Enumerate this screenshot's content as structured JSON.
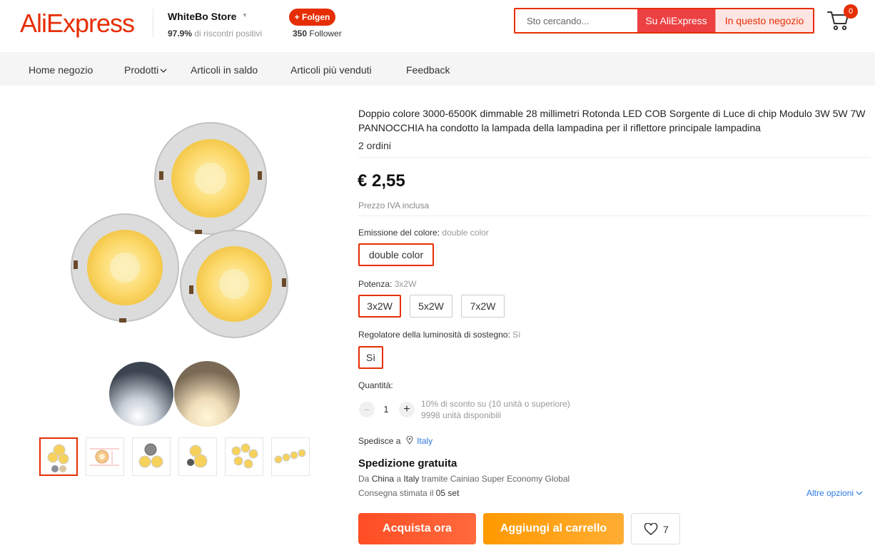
{
  "header": {
    "logo": "AliExpress",
    "store_name": "WhiteBo Store",
    "feedback_percent": "97.9%",
    "feedback_text": " di riscontri positivi",
    "follow_label": "+ Folgen",
    "followers_count": "350",
    "followers_label": " Follower",
    "search_placeholder": "Sto cercando...",
    "search_aliexpress": "Su AliExpress",
    "search_store": "In questo negozio",
    "cart_count": "0"
  },
  "nav": {
    "items": [
      "Home negozio",
      "Prodotti",
      "Articoli in saldo",
      "Articoli più venduti",
      "Feedback"
    ]
  },
  "product": {
    "title": "Doppio colore 3000-6500K dimmable 28 millimetri Rotonda LED COB Sorgente di Luce di chip Modulo 3W 5W 7W PANNOCCHIA ha condotto la lampada della lampadina per il riflettore principale lampadina",
    "orders": "2 ordini",
    "price": "€ 2,55",
    "vat_note": "Prezzo IVA inclusa",
    "color_label": "Emissione del colore:",
    "color_selected": "double color",
    "color_options": [
      "double color"
    ],
    "power_label": "Potenza:",
    "power_selected": "3x2W",
    "power_options": [
      "3x2W",
      "5x2W",
      "7x2W"
    ],
    "dimmer_label": "Regolatore della luminosità di sostegno:",
    "dimmer_selected": "Sì",
    "dimmer_options": [
      "Sì"
    ],
    "quantity_label": "Quantità:",
    "quantity_value": "1",
    "discount_text": "10% di sconto su (10 unità o superiore)",
    "stock_text": "9998 unità disponibili",
    "ship_to_label": "Spedisce a",
    "ship_to_country": "Italy",
    "shipping_title": "Spedizione gratuita",
    "route_from_label": "Da ",
    "route_from": "China",
    "route_to_label": " a ",
    "route_to": "Italy",
    "route_via": " tramite Cainiao Super Economy Global",
    "delivery_label": "Consegna stimata il ",
    "delivery_date": "05 set",
    "more_options": "Altre opzioni",
    "buy_now": "Acquista ora",
    "add_to_cart": "Aggiungi al carrello",
    "wishlist_count": "7"
  },
  "colors": {
    "brand": "#e62e04",
    "buy": "#ff4d24",
    "cart": "#ff9900",
    "link": "#2a7ae2"
  }
}
